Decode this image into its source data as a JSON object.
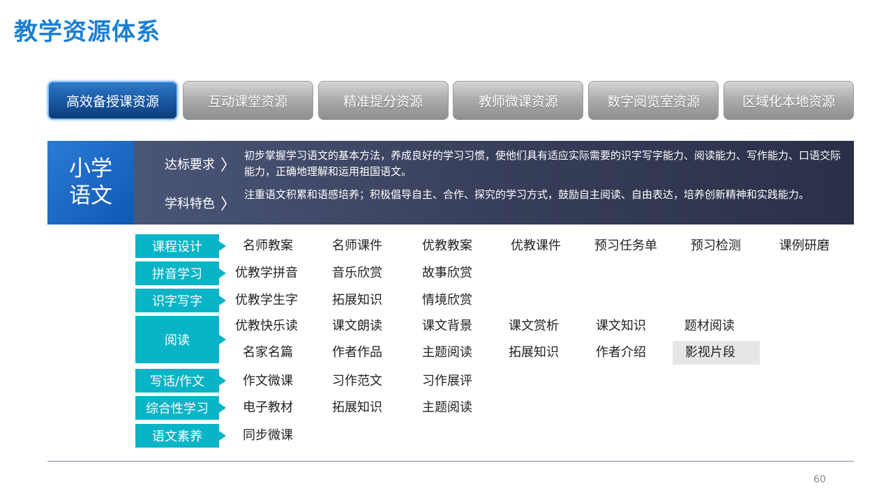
{
  "title": "教学资源体系",
  "tabs": [
    {
      "label": "高效备授课资源",
      "active": true
    },
    {
      "label": "互动课堂资源",
      "active": false
    },
    {
      "label": "精准提分资源",
      "active": false
    },
    {
      "label": "教师微课资源",
      "active": false
    },
    {
      "label": "数字阅览室资源",
      "active": false
    },
    {
      "label": "区域化本地资源",
      "active": false
    }
  ],
  "subject": {
    "name_line1": "小学",
    "name_line2": "语文",
    "standard_label": "达标要求",
    "standard_text": "初步掌握学习语文的基本方法，养成良好的学习习惯，使他们具有适应实际需要的识字写字能力、阅读能力、写作能力、口语交际能力，正确地理解和运用祖国语文。",
    "feature_label": "学科特色",
    "feature_text": "注重语文积累和语感培养；积极倡导自主、合作、探究的学习方式，鼓励自主阅读、自由表达，培养创新精神和实践能力。"
  },
  "categories": [
    {
      "name": "课程设计",
      "items": [
        "名师教案",
        "名师课件",
        "优教教案",
        "优教课件",
        "预习任务单",
        "预习检测",
        "课例研磨"
      ]
    },
    {
      "name": "拼音学习",
      "items": [
        "优教学拼音",
        "音乐欣赏",
        "故事欣赏"
      ]
    },
    {
      "name": "识字写字",
      "items": [
        "优教学生字",
        "拓展知识",
        "情境欣赏"
      ]
    },
    {
      "name": "阅读",
      "items": [
        "优教快乐读",
        "课文朗读",
        "课文背景",
        "课文赏析",
        "课文知识",
        "题材阅读",
        "名家名篇",
        "作者作品",
        "主题阅读",
        "拓展知识",
        "作者介绍",
        "影视片段"
      ]
    },
    {
      "name": "写话/作文",
      "items": [
        "作文微课",
        "习作范文",
        "习作展评"
      ]
    },
    {
      "name": "综合性学习",
      "items": [
        "电子教材",
        "拓展知识",
        "主题阅读"
      ]
    },
    {
      "name": "语文素养",
      "items": [
        "同步微课"
      ]
    }
  ],
  "page_number": "60",
  "colors": {
    "title": "#1a7fd3",
    "category_bg": "#0ab4c7",
    "tab_active": "#1c5ba8",
    "tab_inactive": "#adadad",
    "info_panel": "#383f5a"
  },
  "icons": {
    "chevron": "chevron-right-icon"
  }
}
